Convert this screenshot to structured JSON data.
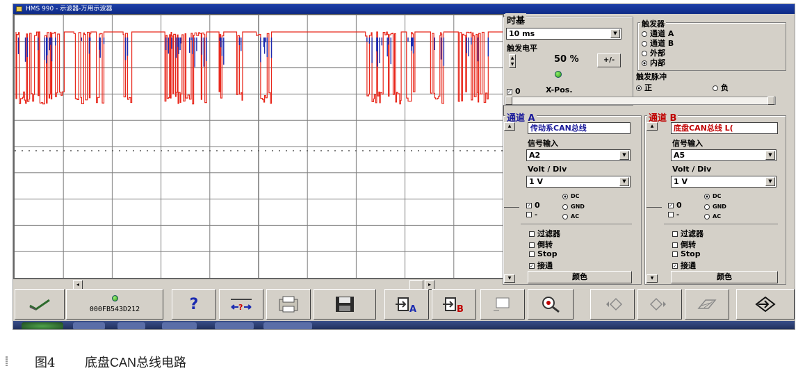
{
  "window": {
    "title": "HMS 990 - 示波器-万用示波器"
  },
  "scope": {
    "colors": {
      "signal_red": "#e8271b",
      "signal_blue": "#1a2ab0",
      "grid": "#7f7f7f",
      "background": "#ffffff"
    }
  },
  "timebase": {
    "label": "时基",
    "value": "10 ms",
    "trigger_level_label": "触发电平",
    "trigger_level_value": "50 %",
    "plus_minus": "+/-",
    "zero_label": "0",
    "xpos_label": "X-Pos."
  },
  "trigger": {
    "label": "触发器",
    "options": [
      "通道 A",
      "通道 B",
      "外部",
      "内部"
    ],
    "selected": "内部",
    "pulse_label": "触发脉冲",
    "pulse_options": [
      "正",
      "负"
    ],
    "pulse_selected": "正"
  },
  "channel_a": {
    "title": "通道 A",
    "name": "传动系CAN总线",
    "signal_input_label": "信号输入",
    "signal_input": "A2",
    "volt_div_label": "Volt / Div",
    "volt_div": "1 V",
    "zero_label": "0",
    "minus_label": "-",
    "coupling": [
      "DC",
      "GND",
      "AC"
    ],
    "coupling_selected": "DC",
    "filter_label": "过滤器",
    "invert_label": "倒转",
    "stop_label": "Stop",
    "connect_label": "接通",
    "color_label": "颜色"
  },
  "channel_b": {
    "title": "通道 B",
    "name": "底盘CAN总线 L(",
    "signal_input_label": "信号输入",
    "signal_input": "A5",
    "volt_div_label": "Volt / Div",
    "volt_div": "1 V",
    "zero_label": "0",
    "minus_label": "-",
    "coupling": [
      "DC",
      "GND",
      "AC"
    ],
    "coupling_selected": "DC",
    "filter_label": "过滤器",
    "invert_label": "倒转",
    "stop_label": "Stop",
    "connect_label": "接通",
    "color_label": "颜色"
  },
  "toolbar": {
    "device_id": "000FB543D212",
    "buttons": [
      "confirm-icon",
      "device-status",
      "help-icon",
      "measure-icon",
      "print-icon",
      "save-icon",
      "channel-a-icon",
      "channel-b-icon",
      "blank-icon",
      "zoom-icon",
      "prev-icon",
      "next-icon",
      "compare-icon",
      "exit-icon"
    ]
  },
  "caption": {
    "figure": "图4",
    "text": "底盘CAN总线电路"
  }
}
